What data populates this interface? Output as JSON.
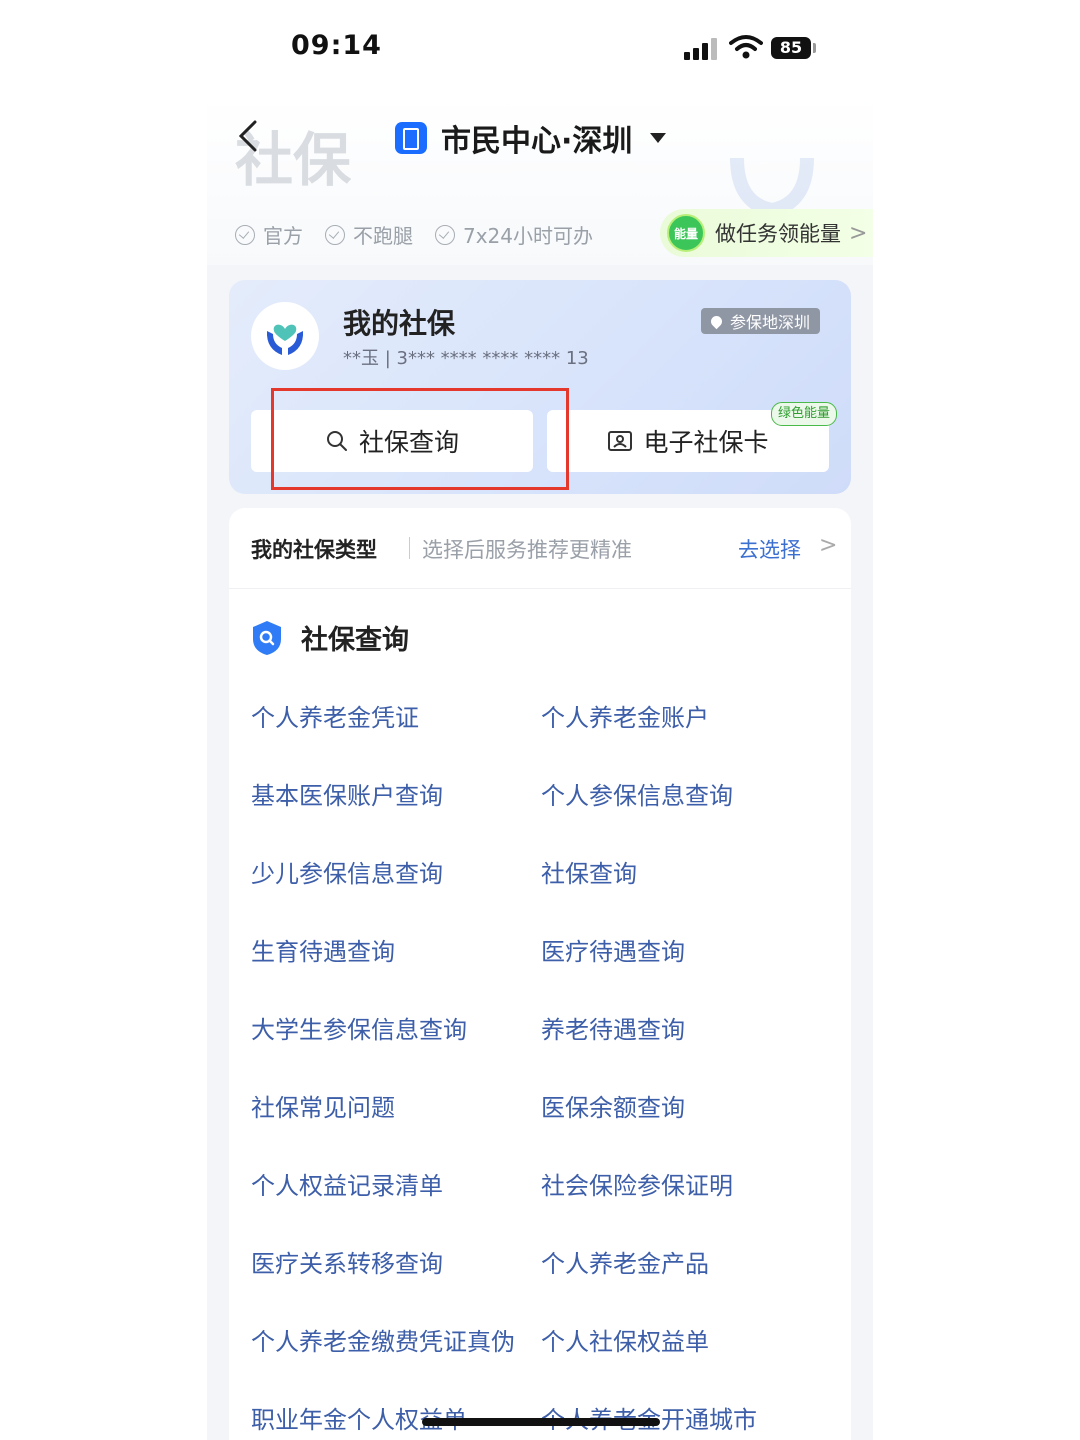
{
  "status_bar": {
    "time": "09:14",
    "battery": "85"
  },
  "nav": {
    "title": "市民中心·深圳",
    "ghost_title": "社保"
  },
  "tags": [
    "官方",
    "不跑腿",
    "7x24小时可办"
  ],
  "energy_task": {
    "badge": "能量",
    "label": "做任务领能量",
    "arrow": ">"
  },
  "card": {
    "title": "我的社保",
    "subtitle": "**玉 | 3*** **** **** **** 13",
    "location": "参保地深圳",
    "query_button": "社保查询",
    "ecard_button": "电子社保卡",
    "green_badge": "绿色能量"
  },
  "type_row": {
    "title": "我的社保类型",
    "desc": "选择后服务推荐更精准",
    "action": "去选择",
    "arrow": ">"
  },
  "section": {
    "title": "社保查询",
    "items": [
      "个人养老金凭证",
      "个人养老金账户",
      "基本医保账户查询",
      "个人参保信息查询",
      "少儿参保信息查询",
      "社保查询",
      "生育待遇查询",
      "医疗待遇查询",
      "大学生参保信息查询",
      "养老待遇查询",
      "社保常见问题",
      "医保余额查询",
      "个人权益记录清单",
      "社会保险参保证明",
      "医疗关系转移查询",
      "个人养老金产品",
      "个人养老金缴费凭证真伪",
      "个人社保权益单",
      "职业年金个人权益单",
      "个人养老金开通城市"
    ]
  },
  "colors": {
    "link": "#3d5ea8",
    "accent": "#1b6dff",
    "highlight": "#e4382c"
  }
}
